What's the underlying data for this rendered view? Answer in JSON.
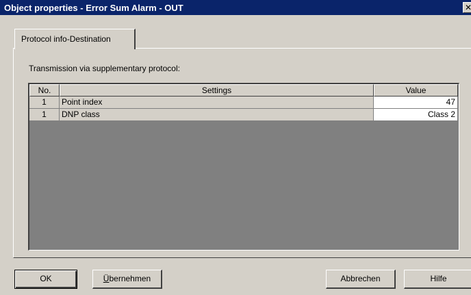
{
  "window": {
    "title": "Object properties - Error Sum Alarm - OUT",
    "close_glyph": "✕"
  },
  "tabs": [
    {
      "label": "Protocol info-Destination",
      "active": true
    }
  ],
  "panel": {
    "intro": "Transmission via supplementary protocol:"
  },
  "grid": {
    "headers": {
      "no": "No.",
      "settings": "Settings",
      "value": "Value"
    },
    "rows": [
      {
        "no": "1",
        "setting": "Point index",
        "value": "47"
      },
      {
        "no": "1",
        "setting": "DNP class",
        "value": "Class 2"
      }
    ]
  },
  "buttons": {
    "ok": "OK",
    "apply_prefix": "Ü",
    "apply_rest": "bernehmen",
    "cancel": "Abbrechen",
    "help": "Hilfe"
  },
  "colors": {
    "titlebar": "#0a246a",
    "dialog_bg": "#d4d0c8",
    "grid_bg": "#808080"
  }
}
